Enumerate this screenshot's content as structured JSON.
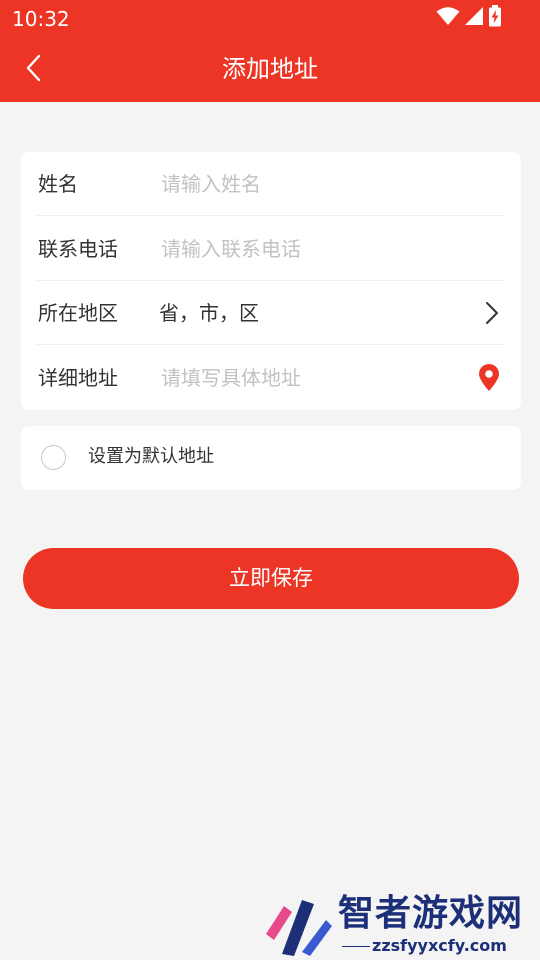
{
  "status_bar": {
    "time": "10:32",
    "icons": [
      "wifi-icon",
      "cellular-signal-icon",
      "battery-charging-icon"
    ]
  },
  "header": {
    "title": "添加地址",
    "back_icon": "chevron-left-icon"
  },
  "form": {
    "name": {
      "label": "姓名",
      "placeholder": "请输入姓名",
      "value": ""
    },
    "phone": {
      "label": "联系电话",
      "placeholder": "请输入联系电话",
      "value": ""
    },
    "region": {
      "label": "所在地区",
      "value": "省，市，区",
      "icon": "chevron-right-icon"
    },
    "detail": {
      "label": "详细地址",
      "placeholder": "请填写具体地址",
      "value": "",
      "icon": "location-pin-icon"
    }
  },
  "default_option": {
    "label": "设置为默认地址",
    "checked": false
  },
  "save_button": {
    "label": "立即保存"
  },
  "watermark": {
    "name": "智者游戏网",
    "url": "zzsfyyxcfy.com"
  },
  "colors": {
    "accent": "#ec3525",
    "background": "#f4f4f4",
    "card": "#ffffff",
    "text": "#333333",
    "placeholder": "#c2c2c2",
    "watermark": "#1c2f78"
  }
}
